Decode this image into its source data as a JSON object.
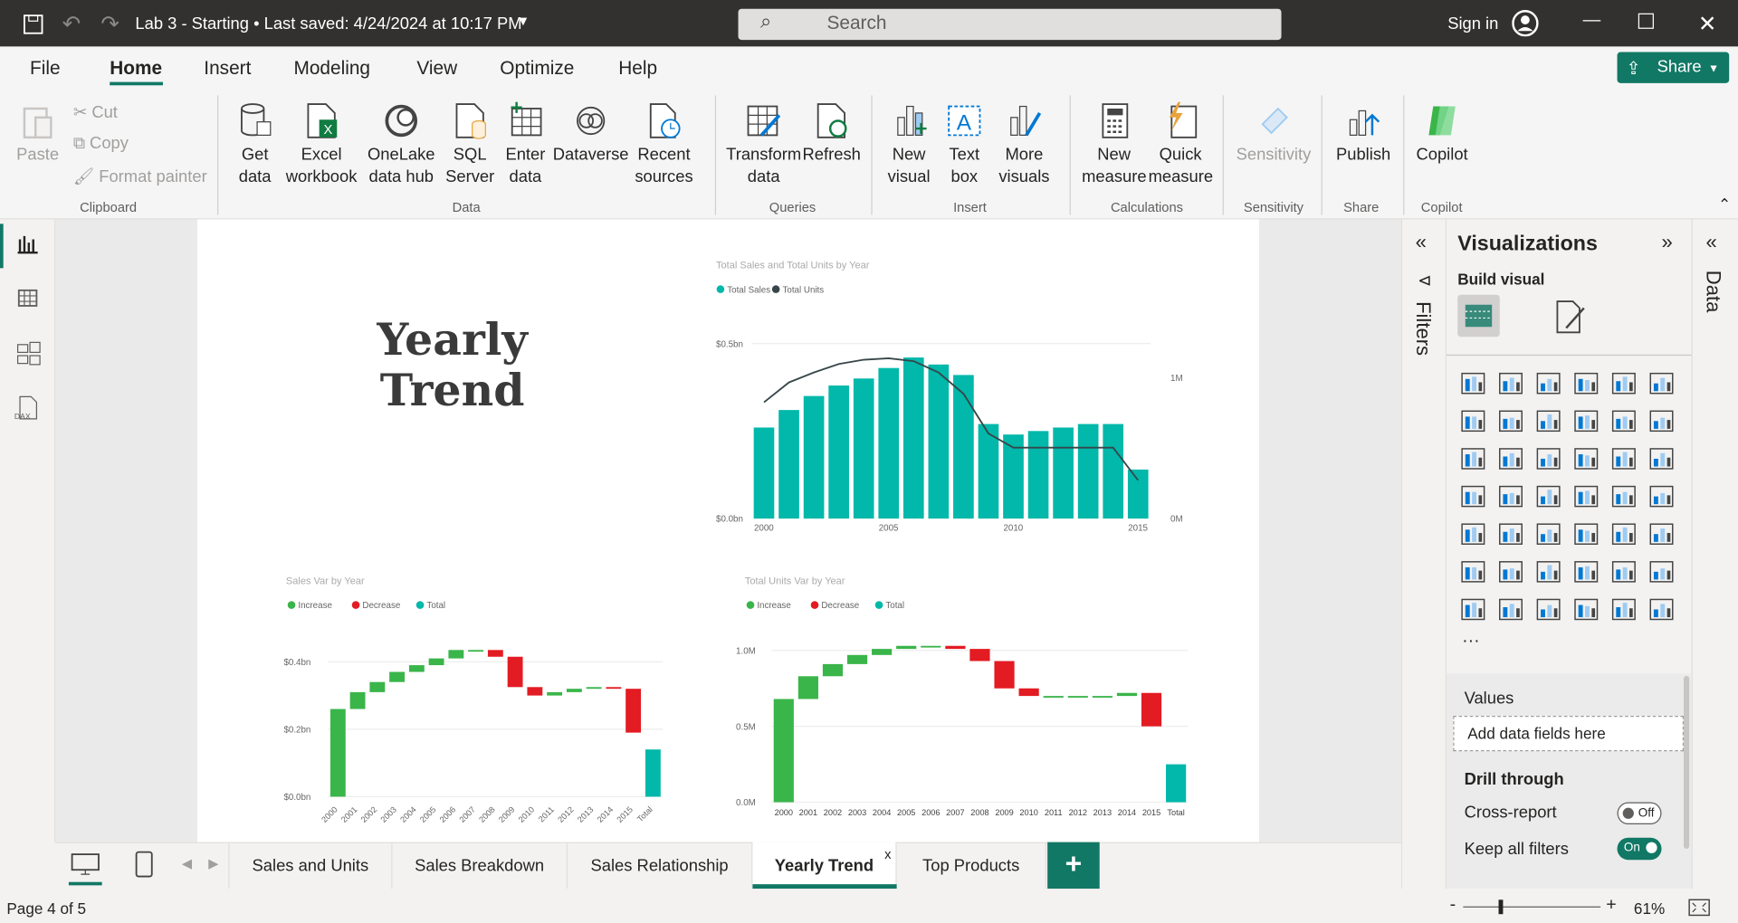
{
  "titlebar": {
    "title": "Lab 3 - Starting  •  Last saved: 4/24/2024 at 10:17 PM",
    "search_placeholder": "Search",
    "signin": "Sign in"
  },
  "menu": {
    "items": [
      "File",
      "Home",
      "Insert",
      "Modeling",
      "View",
      "Optimize",
      "Help"
    ],
    "share": "Share"
  },
  "ribbon": {
    "clipboard": {
      "paste": "Paste",
      "cut": "Cut",
      "copy": "Copy",
      "format_painter": "Format painter",
      "group": "Clipboard"
    },
    "data": {
      "get_data": "Get data",
      "excel": "Excel workbook",
      "onelake": "OneLake data hub",
      "sql": "SQL Server",
      "enter": "Enter data",
      "dataverse": "Dataverse",
      "recent": "Recent sources",
      "group": "Data"
    },
    "queries": {
      "transform": "Transform data",
      "refresh": "Refresh",
      "group": "Queries"
    },
    "insert": {
      "new_visual": "New visual",
      "text_box": "Text box",
      "more_visuals": "More visuals",
      "group": "Insert"
    },
    "calculations": {
      "new_measure": "New measure",
      "quick_measure": "Quick measure",
      "group": "Calculations"
    },
    "sensitivity": {
      "label": "Sensitivity",
      "group": "Sensitivity"
    },
    "share": {
      "publish": "Publish",
      "group": "Share"
    },
    "copilot": {
      "label": "Copilot",
      "group": "Copilot"
    }
  },
  "report": {
    "title_line1": "Yearly",
    "title_line2": "Trend"
  },
  "panes": {
    "filters": "Filters",
    "visualizations": "Visualizations",
    "build_visual": "Build visual",
    "values": "Values",
    "add_fields": "Add data fields here",
    "drill_through": "Drill through",
    "cross_report": "Cross-report",
    "cross_report_state": "Off",
    "keep_filters": "Keep all filters",
    "keep_filters_state": "On",
    "data": "Data"
  },
  "tabs": [
    "Sales and Units",
    "Sales Breakdown",
    "Sales Relationship",
    "Yearly Trend",
    "Top Products"
  ],
  "status": {
    "page": "Page 4 of 5",
    "zoom": "61%"
  },
  "colors": {
    "teal": "#01B8AA",
    "green": "#3AB54A",
    "red": "#E31B23",
    "accent": "#117865"
  },
  "chart_data": [
    {
      "type": "bar",
      "title": "Total Sales and Total Units by Year",
      "legend": [
        "Total Sales",
        "Total Units"
      ],
      "x": [
        2000,
        2001,
        2002,
        2003,
        2004,
        2005,
        2006,
        2007,
        2008,
        2009,
        2010,
        2011,
        2012,
        2013,
        2014,
        2015
      ],
      "xticks": [
        "2000",
        "2005",
        "2010",
        "2015"
      ],
      "series": [
        {
          "name": "Total Sales",
          "values": [
            0.26,
            0.31,
            0.35,
            0.38,
            0.4,
            0.43,
            0.46,
            0.44,
            0.41,
            0.27,
            0.24,
            0.25,
            0.26,
            0.27,
            0.27,
            0.14
          ]
        },
        {
          "name": "Total Units",
          "values": [
            0.82,
            0.96,
            1.03,
            1.09,
            1.12,
            1.13,
            1.11,
            1.03,
            0.88,
            0.6,
            0.5,
            0.5,
            0.5,
            0.5,
            0.5,
            0.27
          ]
        }
      ],
      "yticks_left": [
        "$0.0bn",
        "$0.5bn"
      ],
      "yticks_right": [
        "0M",
        "1M"
      ]
    },
    {
      "type": "waterfall",
      "title": "Sales Var by Year",
      "legend": [
        "Increase",
        "Decrease",
        "Total"
      ],
      "categories": [
        "2000",
        "2001",
        "2002",
        "2003",
        "2004",
        "2005",
        "2006",
        "2007",
        "2008",
        "2009",
        "2010",
        "2011",
        "2012",
        "2013",
        "2014",
        "2015",
        "Total"
      ],
      "deltas": [
        0.26,
        0.05,
        0.03,
        0.03,
        0.02,
        0.02,
        0.025,
        0.0,
        -0.02,
        -0.09,
        -0.025,
        0.01,
        0.01,
        0.005,
        -0.005,
        -0.13,
        0
      ],
      "total": 0.14,
      "yticks": [
        "$0.0bn",
        "$0.2bn",
        "$0.4bn"
      ]
    },
    {
      "type": "waterfall",
      "title": "Total Units Var by Year",
      "legend": [
        "Increase",
        "Decrease",
        "Total"
      ],
      "categories": [
        "2000",
        "2001",
        "2002",
        "2003",
        "2004",
        "2005",
        "2006",
        "2007",
        "2008",
        "2009",
        "2010",
        "2011",
        "2012",
        "2013",
        "2014",
        "2015",
        "Total"
      ],
      "deltas": [
        0.68,
        0.15,
        0.08,
        0.06,
        0.04,
        0.02,
        0.0,
        -0.02,
        -0.08,
        -0.18,
        -0.05,
        0,
        0,
        0,
        0.02,
        -0.22,
        0
      ],
      "total": 0.25,
      "yticks": [
        "0.0M",
        "0.5M",
        "1.0M"
      ]
    }
  ]
}
